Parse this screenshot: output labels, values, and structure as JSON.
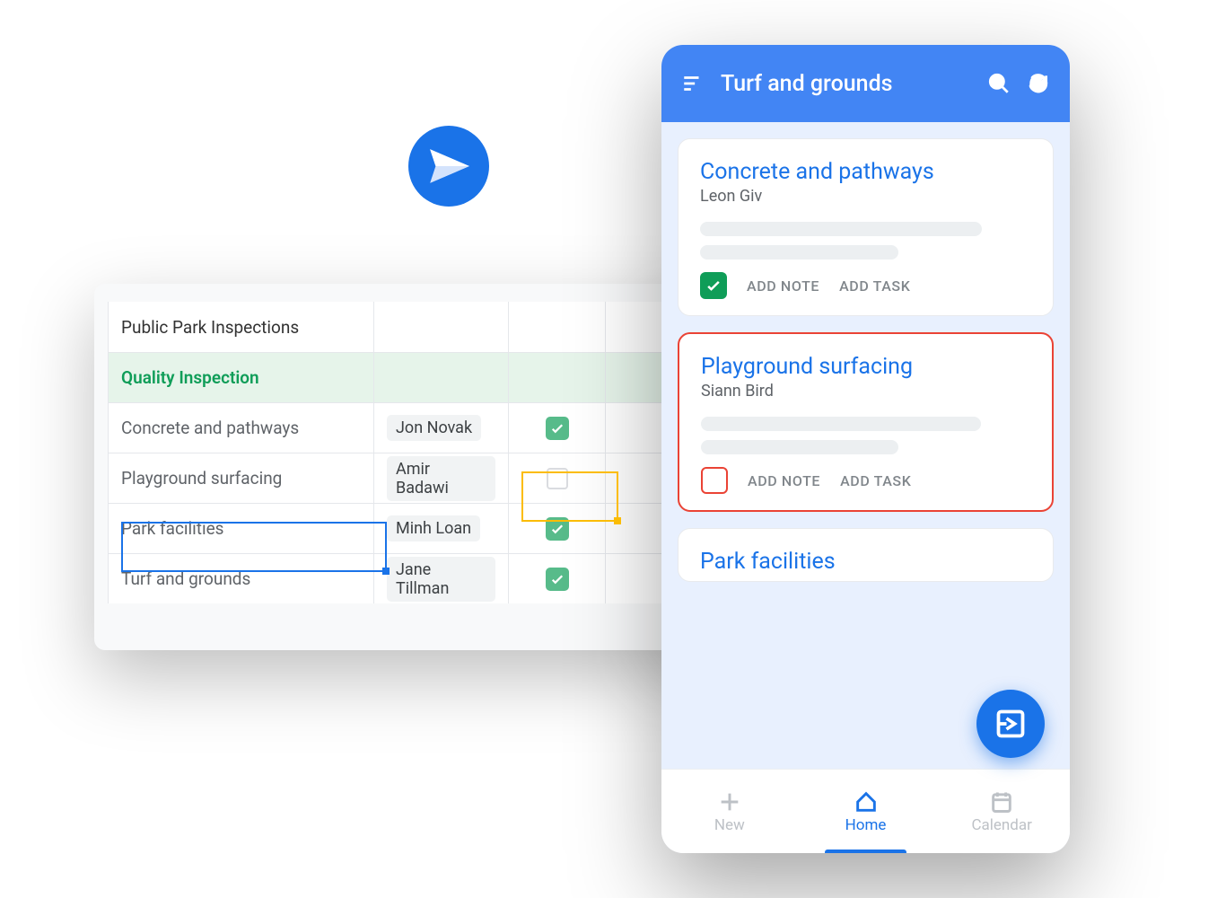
{
  "sheet": {
    "title": "Public Park Inspections",
    "section": "Quality Inspection",
    "rows": [
      {
        "task": "Concrete and pathways",
        "assignee": "Jon Novak",
        "checked": true
      },
      {
        "task": "Playground surfacing",
        "assignee": "Amir Badawi",
        "checked": false
      },
      {
        "task": "Park facilities",
        "assignee": "Minh Loan",
        "checked": true
      },
      {
        "task": "Turf and grounds",
        "assignee": "Jane Tillman",
        "checked": true
      }
    ]
  },
  "phone": {
    "title": "Turf and grounds",
    "cards": [
      {
        "title": "Concrete and pathways",
        "assignee": "Leon Giv",
        "checked": true,
        "alert": false,
        "addNote": "ADD NOTE",
        "addTask": "ADD TASK"
      },
      {
        "title": "Playground surfacing",
        "assignee": "Siann Bird",
        "checked": false,
        "alert": true,
        "addNote": "ADD NOTE",
        "addTask": "ADD TASK"
      },
      {
        "title": "Park facilities"
      }
    ],
    "nav": {
      "new": "New",
      "home": "Home",
      "calendar": "Calendar"
    }
  }
}
